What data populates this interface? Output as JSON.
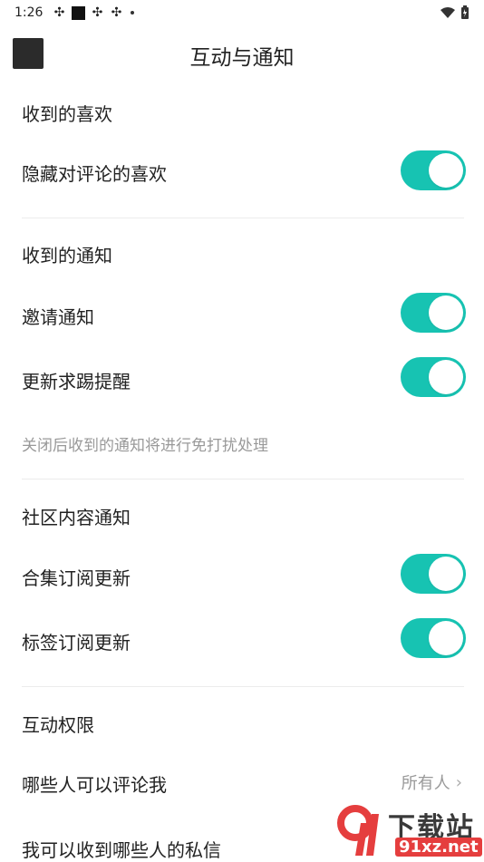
{
  "status": {
    "time": "1:26"
  },
  "header": {
    "title": "互动与通知"
  },
  "sections": {
    "likes": {
      "title": "收到的喜欢",
      "hide_comment_likes": "隐藏对评论的喜欢"
    },
    "notify": {
      "title": "收到的通知",
      "invite": "邀请通知",
      "update_reminder": "更新求踢提醒",
      "hint": "关闭后收到的通知将进行免打扰处理"
    },
    "community": {
      "title": "社区内容通知",
      "collection_update": "合集订阅更新",
      "tag_update": "标签订阅更新"
    },
    "permissions": {
      "title": "互动权限",
      "who_can_comment": "哪些人可以评论我",
      "who_can_comment_value": "所有人",
      "dm_from": "我可以收到哪些人的私信"
    }
  },
  "toggles": {
    "hide_comment_likes": true,
    "invite": true,
    "update_reminder": true,
    "collection_update": true,
    "tag_update": true
  },
  "colors": {
    "accent": "#17c3b2",
    "watermark": "#e53e3e"
  },
  "watermark": {
    "line1": "下载站",
    "line2": "91xz.net"
  }
}
